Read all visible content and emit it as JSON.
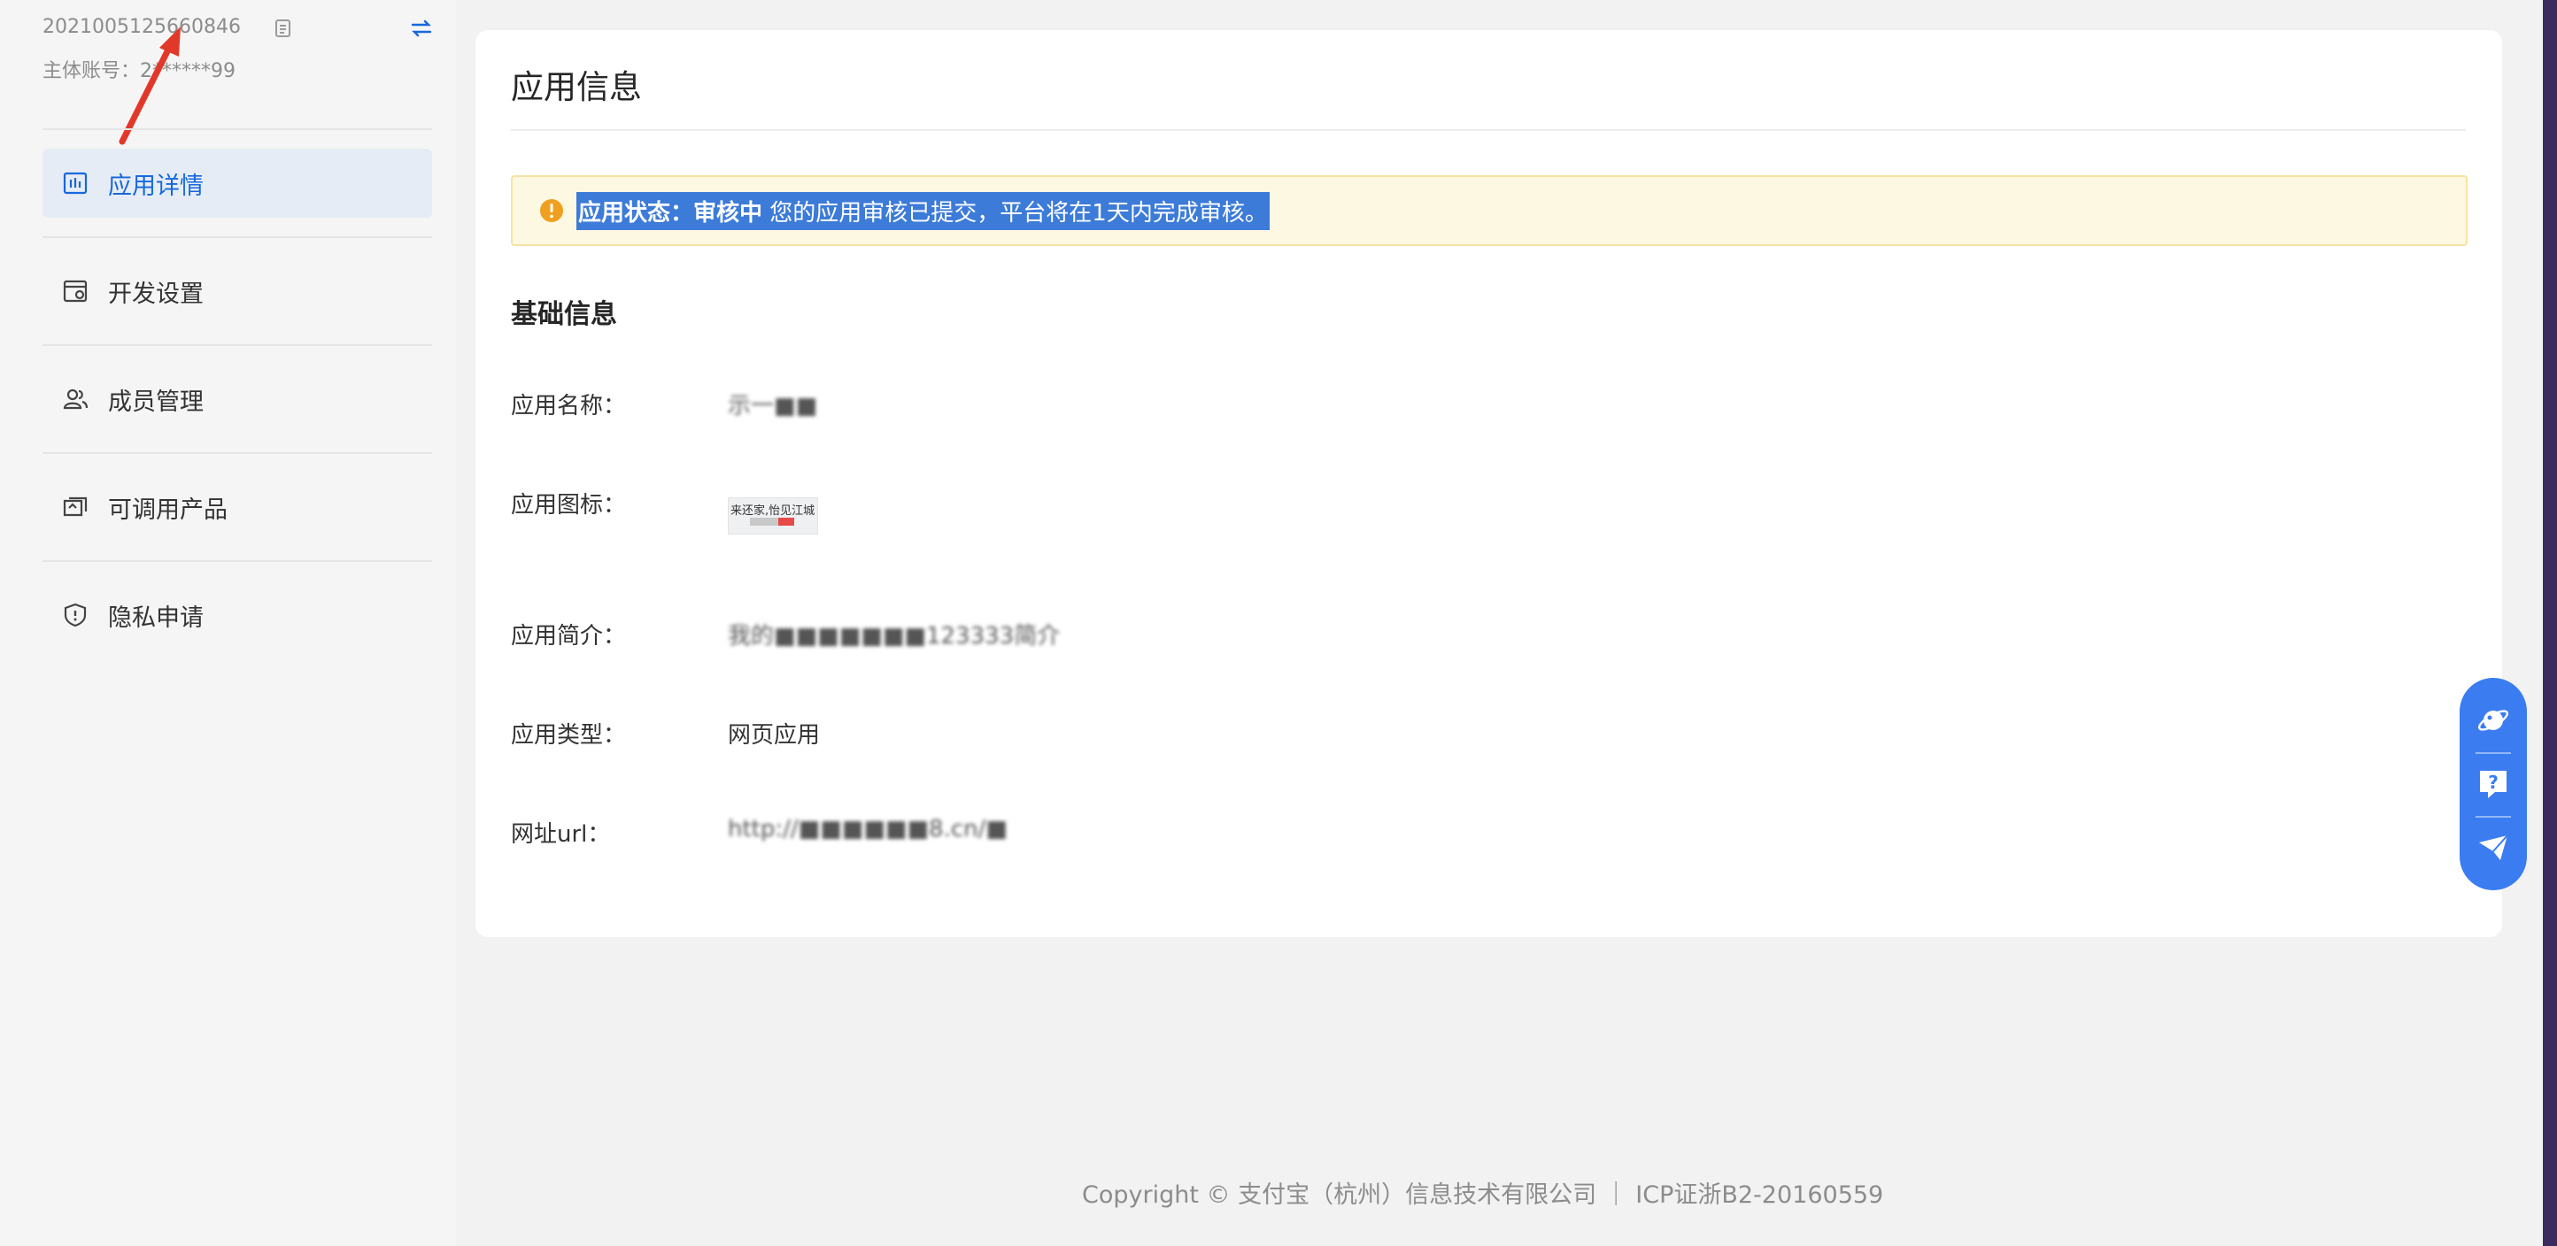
{
  "sidebar": {
    "app_id": "2021005125660846",
    "main_account_label": "主体账号：",
    "main_account_value": "2******99",
    "items": [
      {
        "label": "应用详情",
        "icon": "chart-bar-icon",
        "active": true
      },
      {
        "label": "开发设置",
        "icon": "dev-settings-icon",
        "active": false
      },
      {
        "label": "成员管理",
        "icon": "users-icon",
        "active": false
      },
      {
        "label": "可调用产品",
        "icon": "products-icon",
        "active": false
      },
      {
        "label": "隐私申请",
        "icon": "shield-icon",
        "active": false
      }
    ]
  },
  "card": {
    "title": "应用信息",
    "alert": {
      "status_label": "应用状态：审核中",
      "message": " 您的应用审核已提交，平台将在1天内完成审核。"
    },
    "section_title": "基础信息",
    "fields": {
      "name": {
        "label": "应用名称：",
        "value": "示一■■"
      },
      "icon": {
        "label": "应用图标：",
        "thumb_text": "来还家,怡见江城"
      },
      "intro": {
        "label": "应用简介：",
        "value": "我的■■■■■■■123333简介"
      },
      "type": {
        "label": "应用类型：",
        "value": "网页应用"
      },
      "url": {
        "label": "网址url：",
        "value": "http://■■■■■■8.cn/■"
      }
    }
  },
  "footer": {
    "text": "Copyright © 支付宝（杭州）信息技术有限公司 ｜ ICP证浙B2-20160559"
  },
  "float_toolbar": {
    "buttons": [
      "planet-icon",
      "help-icon",
      "feedback-icon"
    ]
  },
  "colors": {
    "accent": "#1668dc",
    "alert_bg": "#fdf8e2",
    "alert_icon": "#f0a020",
    "selection": "#3d7bd9",
    "float_bar": "#3b7cf0"
  }
}
